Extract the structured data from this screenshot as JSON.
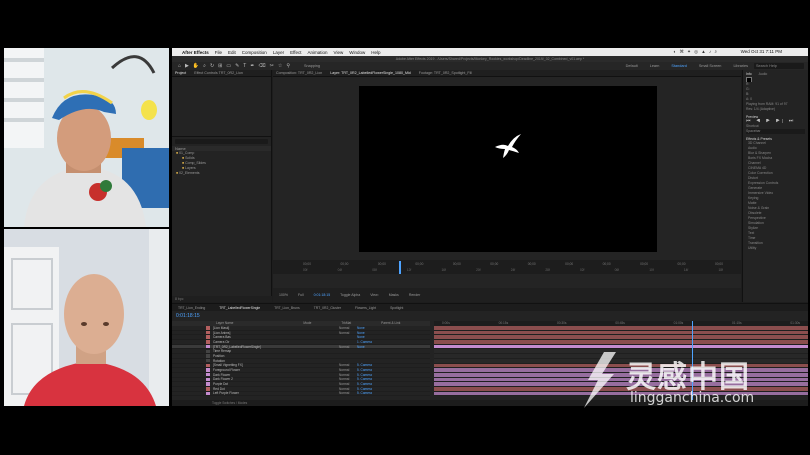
{
  "menubar": {
    "app_name": "After Effects",
    "items": [
      "File",
      "Edit",
      "Composition",
      "Layer",
      "Effect",
      "Animation",
      "View",
      "Window",
      "Help"
    ],
    "status_icons": "◐ ⌘ ✦ ◎ ▲ ♪ ⌕",
    "clock": "Wed Oct 31 7:11 PM"
  },
  "titlebar": {
    "text": "Adobe After Effects 2019 - /Users/Shared/Projects/Monkey_Rookies_workshop/Deadline_2019/_02_Combined_v01.aep *"
  },
  "toolbar": {
    "tools": [
      "⌂",
      "▶",
      "✋",
      "⌕",
      "↻",
      "⊞",
      "▭",
      "✎",
      "T",
      "✒",
      "⌫",
      "✂",
      "☆",
      "⚲"
    ],
    "snapping": "Snapping",
    "workspaces": [
      "Default",
      "Learn",
      "Standard",
      "Small Screen",
      "Libraries"
    ],
    "active_workspace": "Standard",
    "search_help": "Search Help"
  },
  "project_panel": {
    "tabs": [
      "Project",
      "Effect Controls TRT_0R2_Lion"
    ],
    "search_placeholder": "",
    "column_header": "Name",
    "folders": [
      "01_Comp",
      "Solids",
      "Comp_Slides",
      "Layers",
      "02_Elements"
    ],
    "footer": "8 bpc"
  },
  "viewer": {
    "tabs": [
      "Composition: TRT_0R2_Lion",
      "Layer: TRT_0R2_LabelledFlowerSingle_1080_Mid",
      "Footage: TRT_0R2_Spotlight_Fill"
    ],
    "ruler_ticks_top": [
      "00;00",
      "00;00",
      "00;00",
      "00;00",
      "00;00",
      "00;00",
      "00;00",
      "00;00",
      "00;00",
      "00;00",
      "00;00",
      "00;00"
    ],
    "ruler_ticks_bottom": [
      "00f",
      "04f",
      "08f",
      "12f",
      "16f",
      "20f",
      "24f",
      "28f",
      "02f",
      "06f",
      "10f",
      "14f",
      "18f"
    ],
    "footer_items": [
      "100%",
      "Full",
      "0:01:18:15",
      "Toggle Alpha",
      "View:",
      "Masks"
    ],
    "render_label": "Render"
  },
  "right_panel": {
    "info_tabs": [
      "Info",
      "Audio"
    ],
    "info_lines": [
      "R:",
      "G:",
      "B:",
      "A: 0",
      "Playing from RAM: 91 of 97",
      "Res: 1/4 (Adaptive)"
    ],
    "preview_label": "Preview",
    "transport": "⏮ ◀ ▶ ▶| ⏭",
    "shortcut_label": "Shortcut",
    "shortcut_value": "Spacebar",
    "effects_label": "Effects & Presets",
    "effects": [
      "3D Channel",
      "Audio",
      "Blur & Sharpen",
      "Boris FX Mocha",
      "Channel",
      "CINEMA 4D",
      "Color Correction",
      "Distort",
      "Expression Controls",
      "Generate",
      "Immersive Video",
      "Keying",
      "Matte",
      "Noise & Grain",
      "Obsolete",
      "Perspective",
      "Simulation",
      "Stylize",
      "Text",
      "Time",
      "Transition",
      "Utility"
    ]
  },
  "timeline": {
    "tabs": [
      "TRT_Lion_Ending",
      "TRT_LabelledFlowerSingle",
      "TRT_Lion_Bruns",
      "TRT_0R2_Cluster",
      "Flowers_Light",
      "Spotlight"
    ],
    "current_time": "0:01:18:15",
    "column_headers": [
      "Layer Name",
      "Mode",
      "TrkMat",
      "Parent & Link"
    ],
    "layers": [
      {
        "name": "[Lion Mask]",
        "color": "#b35f5f",
        "mode": "Normal",
        "parent": "None",
        "selected": false
      },
      {
        "name": "[Lion Anims]",
        "color": "#b35f5f",
        "mode": "Normal",
        "parent": "None",
        "selected": false
      },
      {
        "name": "Camera Bas",
        "color": "#b35f5f",
        "mode": "",
        "parent": "None",
        "selected": false
      },
      {
        "name": "Camera Ctr",
        "color": "#b35f5f",
        "mode": "",
        "parent": "1. Camera",
        "selected": false
      },
      {
        "name": "[TRT_0R2_LabelledFlowerSingle]",
        "color": "#c48ccf",
        "mode": "Normal",
        "parent": "None",
        "selected": true
      },
      {
        "name": "Time Remap",
        "color": "#444444",
        "mode": "",
        "parent": "",
        "selected": false
      },
      {
        "name": "Position",
        "color": "#444444",
        "mode": "",
        "parent": "",
        "selected": false
      },
      {
        "name": "Rotation",
        "color": "#444444",
        "mode": "",
        "parent": "",
        "selected": false
      },
      {
        "name": "[Small Vignetting FX]",
        "color": "#b35f5f",
        "mode": "Normal",
        "parent": "5. Camera",
        "selected": false
      },
      {
        "name": "Foreground Flower",
        "color": "#c48ccf",
        "mode": "Normal",
        "parent": "5. Camera",
        "selected": false
      },
      {
        "name": "Dark Flower",
        "color": "#c48ccf",
        "mode": "Normal",
        "parent": "5. Camera",
        "selected": false
      },
      {
        "name": "Dark Flower 2",
        "color": "#c48ccf",
        "mode": "Normal",
        "parent": "5. Camera",
        "selected": false
      },
      {
        "name": "Purple Dot",
        "color": "#c48ccf",
        "mode": "Normal",
        "parent": "5. Camera",
        "selected": false
      },
      {
        "name": "Red Dot",
        "color": "#b35f5f",
        "mode": "Normal",
        "parent": "5. Camera",
        "selected": false
      },
      {
        "name": "Left Purple Flower",
        "color": "#c48ccf",
        "mode": "Normal",
        "parent": "5. Camera",
        "selected": false
      }
    ],
    "ruler_ticks": [
      "0:00s",
      "00:15s",
      "00:30s",
      "00:45s",
      "01:00s",
      "01:15s",
      "01:30s"
    ],
    "footer": "Toggle Switches / Modes"
  },
  "watermark": {
    "chinese": "灵感中国",
    "english": "lingganchina.com"
  }
}
